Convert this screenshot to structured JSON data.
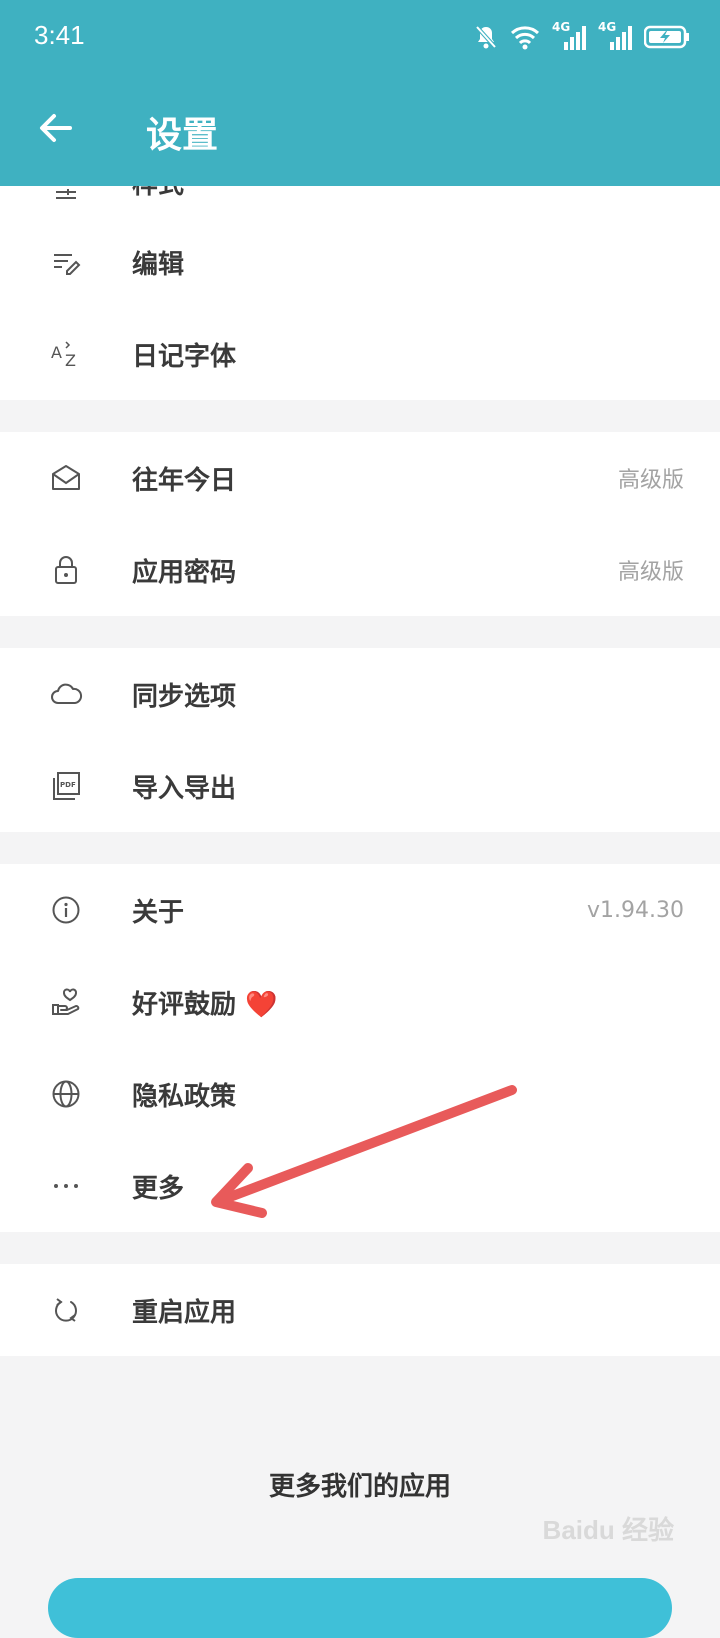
{
  "status_bar": {
    "time": "3:41",
    "icons": [
      "mute-bell-icon",
      "wifi-icon",
      "4g-signal-icon",
      "4g-signal-icon",
      "battery-charging-icon"
    ],
    "network_label_1": "4G",
    "network_label_2": "4G"
  },
  "header": {
    "back_icon": "arrow-left-icon",
    "title": "设置",
    "bg_color": "#3fb1c1"
  },
  "groups": [
    {
      "items": [
        {
          "icon": "sliders-icon",
          "label": "样式"
        },
        {
          "icon": "edit-lines-icon",
          "label": "编辑"
        },
        {
          "icon": "font-az-icon",
          "label": "日记字体"
        }
      ]
    },
    {
      "items": [
        {
          "icon": "envelope-icon",
          "label": "往年今日",
          "value": "高级版"
        },
        {
          "icon": "lock-icon",
          "label": "应用密码",
          "value": "高级版"
        }
      ]
    },
    {
      "items": [
        {
          "icon": "cloud-icon",
          "label": "同步选项"
        },
        {
          "icon": "pdf-icon",
          "label": "导入导出"
        }
      ]
    },
    {
      "items": [
        {
          "icon": "info-icon",
          "label": "关于",
          "value": "v1.94.30"
        },
        {
          "icon": "heart-hand-icon",
          "label": "好评鼓励",
          "emoji": "❤️"
        },
        {
          "icon": "globe-icon",
          "label": "隐私政策"
        },
        {
          "icon": "more-dots-icon",
          "label": "更多"
        }
      ]
    },
    {
      "items": [
        {
          "icon": "restart-icon",
          "label": "重启应用"
        }
      ]
    }
  ],
  "footer": {
    "title": "更多我们的应用"
  },
  "watermark": "Baidu 经验",
  "annotation_arrow_color": "#e85a5a"
}
